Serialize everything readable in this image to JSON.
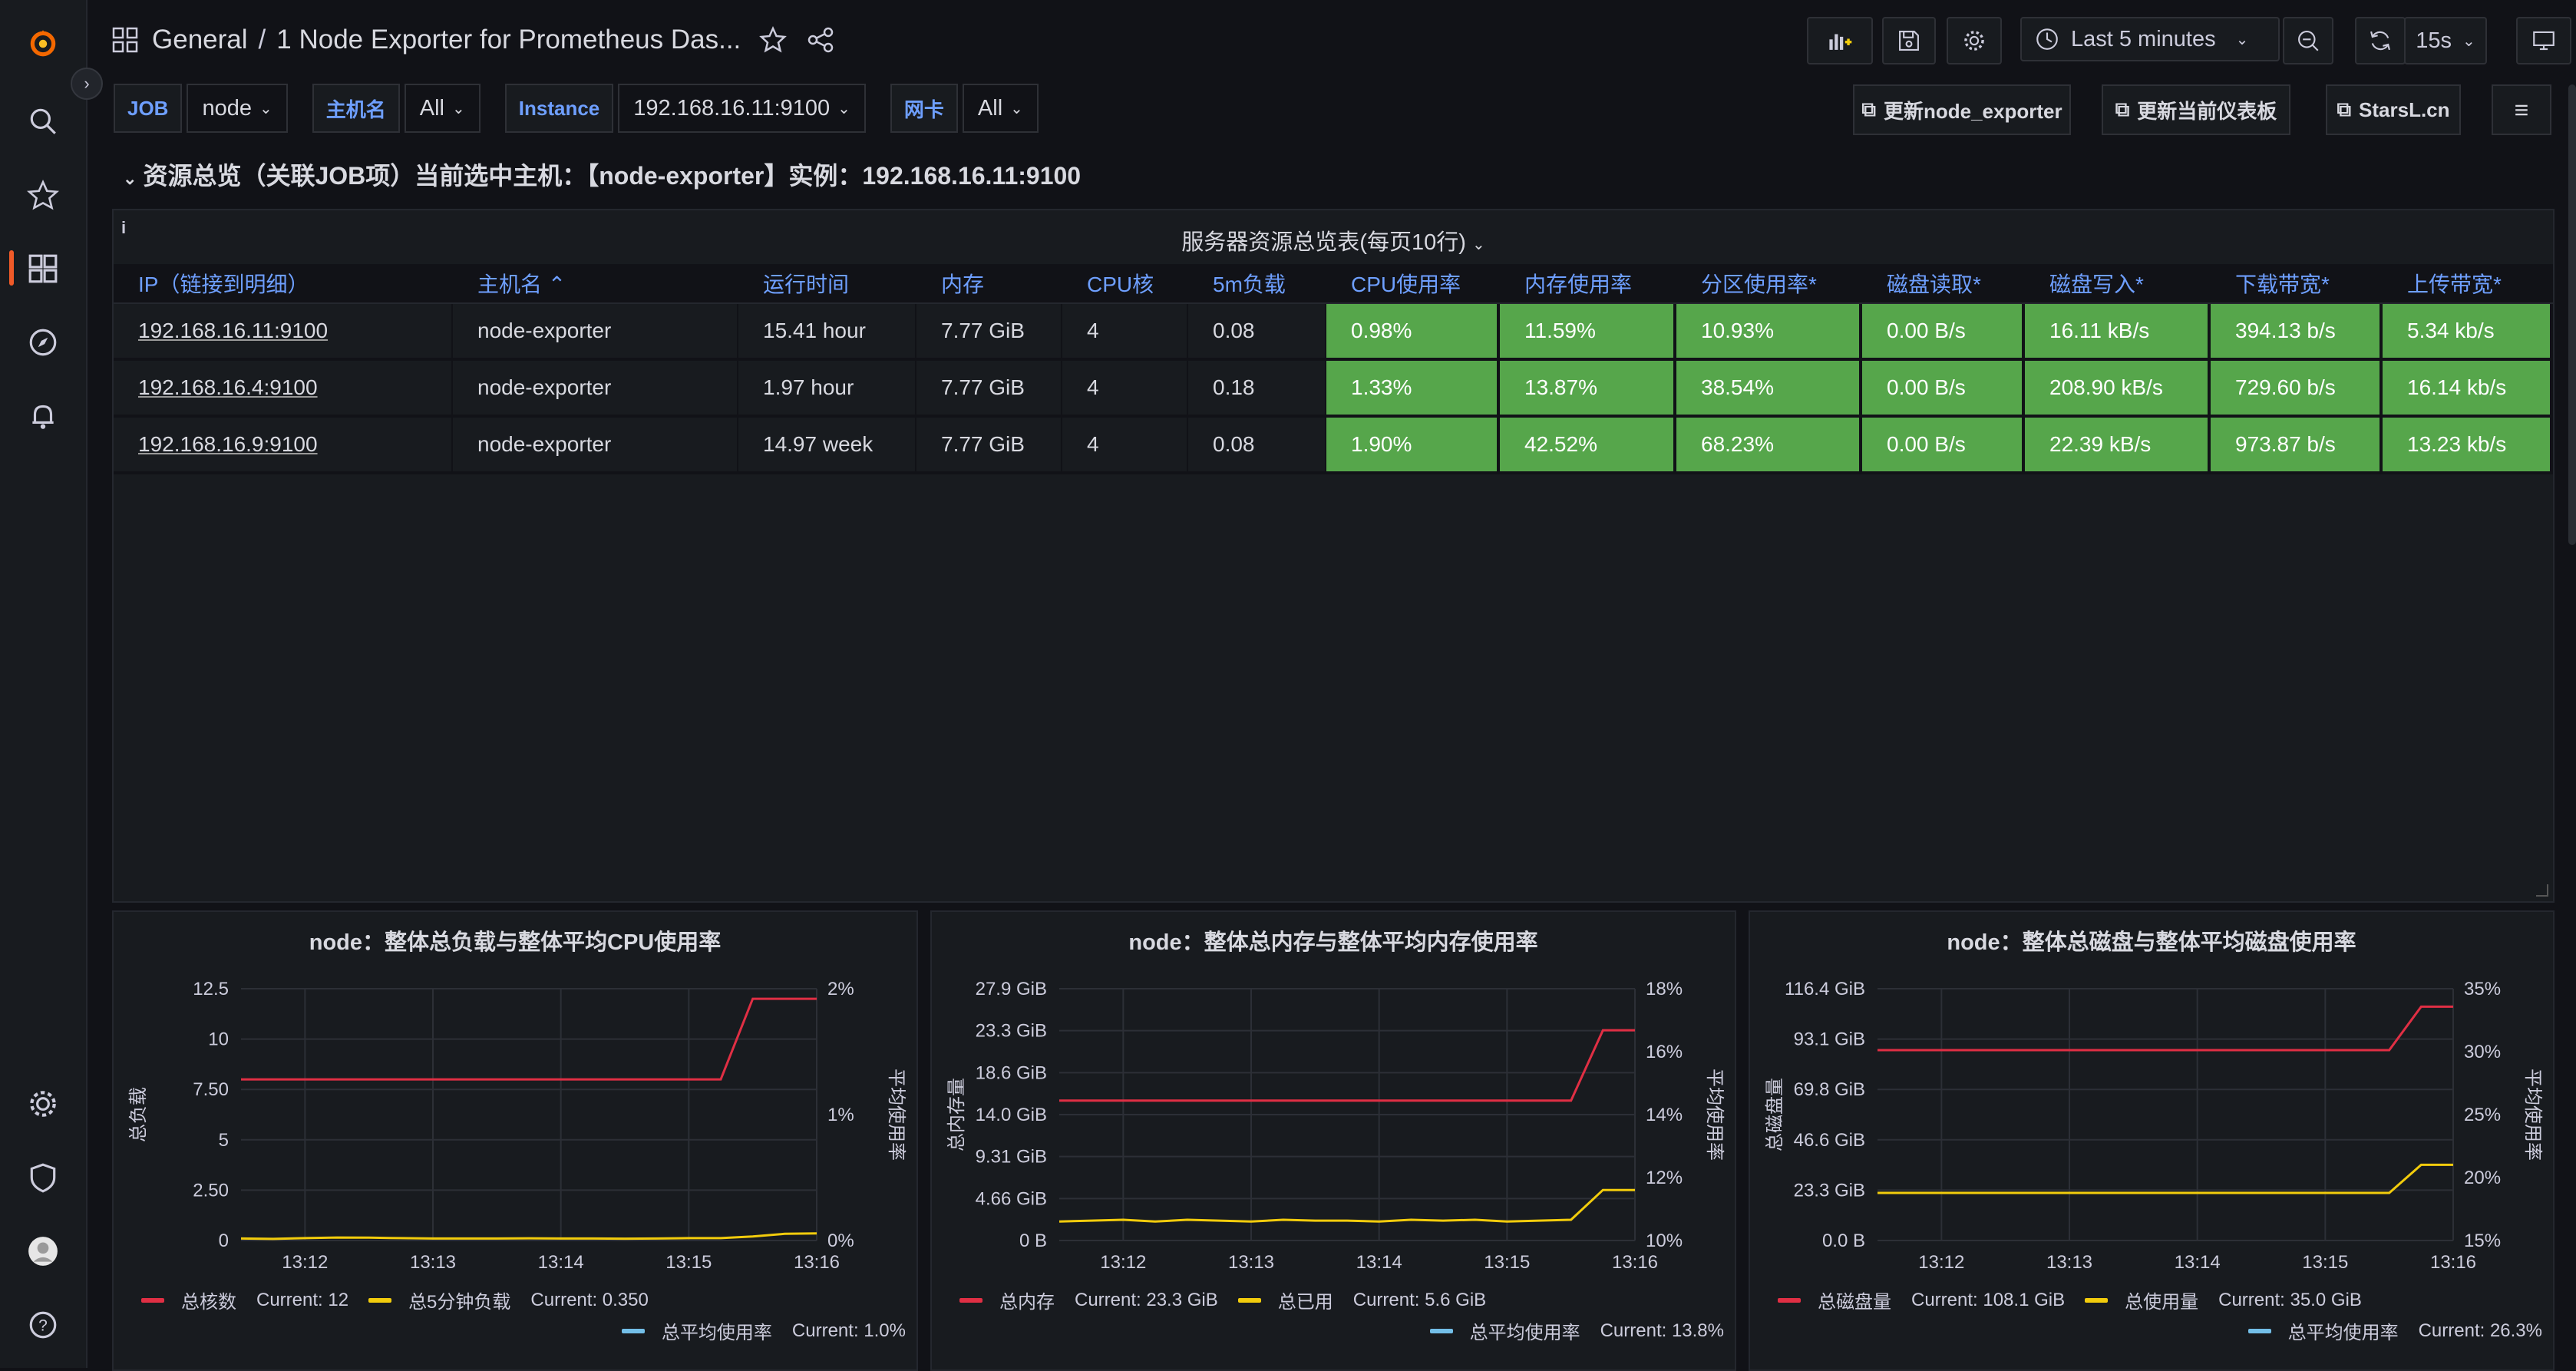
{
  "breadcrumb": {
    "folder": "General",
    "separator": "/",
    "title": "1 Node Exporter for Prometheus Das..."
  },
  "toolbar": {
    "time_range": "Last 5 minutes",
    "refresh_interval": "15s"
  },
  "variables": [
    {
      "label": "JOB",
      "value": "node"
    },
    {
      "label": "主机名",
      "value": "All"
    },
    {
      "label": "Instance",
      "value": "192.168.16.11:9100"
    },
    {
      "label": "网卡",
      "value": "All"
    }
  ],
  "links": [
    "更新node_exporter",
    "更新当前仪表板",
    "StarsL.cn"
  ],
  "row_title": "资源总览（关联JOB项）当前选中主机：【node-exporter】实例：192.168.16.11:9100",
  "table": {
    "title": "服务器资源总览表(每页10行)",
    "headers": [
      "IP（链接到明细）",
      "主机名 ⌃",
      "运行时间",
      "内存",
      "CPU核",
      "5m负载",
      "CPU使用率",
      "内存使用率",
      "分区使用率*",
      "磁盘读取*",
      "磁盘写入*",
      "下载带宽*",
      "上传带宽*"
    ],
    "rows": [
      [
        "192.168.16.11:9100",
        "node-exporter",
        "15.41 hour",
        "7.77 GiB",
        "4",
        "0.08",
        "0.98%",
        "11.59%",
        "10.93%",
        "0.00 B/s",
        "16.11 kB/s",
        "394.13 b/s",
        "5.34 kb/s"
      ],
      [
        "192.168.16.4:9100",
        "node-exporter",
        "1.97 hour",
        "7.77 GiB",
        "4",
        "0.18",
        "1.33%",
        "13.87%",
        "38.54%",
        "0.00 B/s",
        "208.90 kB/s",
        "729.60 b/s",
        "16.14 kb/s"
      ],
      [
        "192.168.16.9:9100",
        "node-exporter",
        "14.97 week",
        "7.77 GiB",
        "4",
        "0.08",
        "1.90%",
        "42.52%",
        "68.23%",
        "0.00 B/s",
        "22.39 kB/s",
        "973.87 b/s",
        "13.23 kb/s"
      ]
    ]
  },
  "colors": {
    "red": "#e02f44",
    "yellow": "#f2cc0c",
    "blue": "#73bfe8",
    "green": "#56a64b",
    "accent": "#6e9fff"
  },
  "chart_data": [
    {
      "type": "line",
      "title": "node：整体总负载与整体平均CPU使用率",
      "ylabel": "总负载",
      "y2label": "平均使用率",
      "x": [
        "13:11:30",
        "13:11:45",
        "13:12",
        "13:12:15",
        "13:12:30",
        "13:12:45",
        "13:13",
        "13:13:15",
        "13:13:30",
        "13:13:45",
        "13:14",
        "13:14:15",
        "13:14:30",
        "13:14:45",
        "13:15",
        "13:15:15",
        "13:15:30",
        "13:15:45",
        "13:16"
      ],
      "xticks": [
        "13:12",
        "13:13",
        "13:14",
        "13:15",
        "13:16"
      ],
      "yticks": [
        "0",
        "2.50",
        "5",
        "7.50",
        "10",
        "12.5"
      ],
      "y2ticks": [
        "0%",
        "1%",
        "2%"
      ],
      "ylim": [
        0,
        12.5
      ],
      "y2lim": [
        0,
        2
      ],
      "series": [
        {
          "name": "总核数",
          "axis": "left",
          "color": "#e02f44",
          "current": "Current: 12",
          "values": [
            8,
            8,
            8,
            8,
            8,
            8,
            8,
            8,
            8,
            8,
            8,
            8,
            8,
            8,
            8,
            8,
            12,
            12,
            12
          ]
        },
        {
          "name": "总5分钟负载",
          "axis": "left",
          "color": "#f2cc0c",
          "current": "Current: 0.350",
          "values": [
            0.1,
            0.08,
            0.12,
            0.15,
            0.14,
            0.12,
            0.1,
            0.1,
            0.1,
            0.11,
            0.1,
            0.1,
            0.09,
            0.1,
            0.12,
            0.12,
            0.2,
            0.33,
            0.35
          ]
        },
        {
          "name": "总平均使用率",
          "axis": "right",
          "color": "#73bfe8",
          "current": "Current: 1.0%",
          "values": []
        }
      ]
    },
    {
      "type": "line",
      "title": "node：整体总内存与整体平均内存使用率",
      "ylabel": "总内存量",
      "y2label": "平均使用率",
      "x": [
        "13:11:30",
        "13:11:45",
        "13:12",
        "13:12:15",
        "13:12:30",
        "13:12:45",
        "13:13",
        "13:13:15",
        "13:13:30",
        "13:13:45",
        "13:14",
        "13:14:15",
        "13:14:30",
        "13:14:45",
        "13:15",
        "13:15:15",
        "13:15:30",
        "13:15:45",
        "13:16"
      ],
      "xticks": [
        "13:12",
        "13:13",
        "13:14",
        "13:15",
        "13:16"
      ],
      "yticks": [
        "0 B",
        "4.66 GiB",
        "9.31 GiB",
        "14.0 GiB",
        "18.6 GiB",
        "23.3 GiB",
        "27.9 GiB"
      ],
      "y2ticks": [
        "10%",
        "12%",
        "14%",
        "16%",
        "18%"
      ],
      "ylim": [
        0,
        27.9
      ],
      "y2lim": [
        10,
        18
      ],
      "series": [
        {
          "name": "总内存",
          "axis": "left",
          "color": "#e02f44",
          "current": "Current: 23.3 GiB",
          "values": [
            15.5,
            15.5,
            15.5,
            15.5,
            15.5,
            15.5,
            15.5,
            15.5,
            15.5,
            15.5,
            15.5,
            15.5,
            15.5,
            15.5,
            15.5,
            15.5,
            15.5,
            23.3,
            23.3
          ]
        },
        {
          "name": "总已用",
          "axis": "left",
          "color": "#f2cc0c",
          "current": "Current: 5.6 GiB",
          "values": [
            2.1,
            2.2,
            2.3,
            2.1,
            2.3,
            2.2,
            2.1,
            2.3,
            2.2,
            2.2,
            2.1,
            2.3,
            2.2,
            2.3,
            2.1,
            2.2,
            2.3,
            5.6,
            5.6
          ]
        },
        {
          "name": "总平均使用率",
          "axis": "right",
          "color": "#73bfe8",
          "current": "Current: 13.8%",
          "values": []
        }
      ]
    },
    {
      "type": "line",
      "title": "node：整体总磁盘与整体平均磁盘使用率",
      "ylabel": "总磁盘量",
      "y2label": "平均使用率",
      "x": [
        "13:11:30",
        "13:11:45",
        "13:12",
        "13:12:15",
        "13:12:30",
        "13:12:45",
        "13:13",
        "13:13:15",
        "13:13:30",
        "13:13:45",
        "13:14",
        "13:14:15",
        "13:14:30",
        "13:14:45",
        "13:15",
        "13:15:15",
        "13:15:30",
        "13:15:45",
        "13:16"
      ],
      "xticks": [
        "13:12",
        "13:13",
        "13:14",
        "13:15",
        "13:16"
      ],
      "yticks": [
        "0.0 B",
        "23.3 GiB",
        "46.6 GiB",
        "69.8 GiB",
        "93.1 GiB",
        "116.4 GiB"
      ],
      "y2ticks": [
        "15%",
        "20%",
        "25%",
        "30%",
        "35%"
      ],
      "ylim": [
        0,
        116.4
      ],
      "y2lim": [
        15,
        35
      ],
      "series": [
        {
          "name": "总磁盘量",
          "axis": "left",
          "color": "#e02f44",
          "current": "Current: 108.1 GiB",
          "values": [
            88,
            88,
            88,
            88,
            88,
            88,
            88,
            88,
            88,
            88,
            88,
            88,
            88,
            88,
            88,
            88,
            88,
            108.1,
            108.1
          ]
        },
        {
          "name": "总使用量",
          "axis": "left",
          "color": "#f2cc0c",
          "current": "Current: 35.0 GiB",
          "values": [
            22,
            22,
            22,
            22,
            22,
            22,
            22,
            22,
            22,
            22,
            22,
            22,
            22,
            22,
            22,
            22,
            22,
            35,
            35
          ]
        },
        {
          "name": "总平均使用率",
          "axis": "right",
          "color": "#73bfe8",
          "current": "Current: 26.3%",
          "values": []
        }
      ]
    }
  ]
}
